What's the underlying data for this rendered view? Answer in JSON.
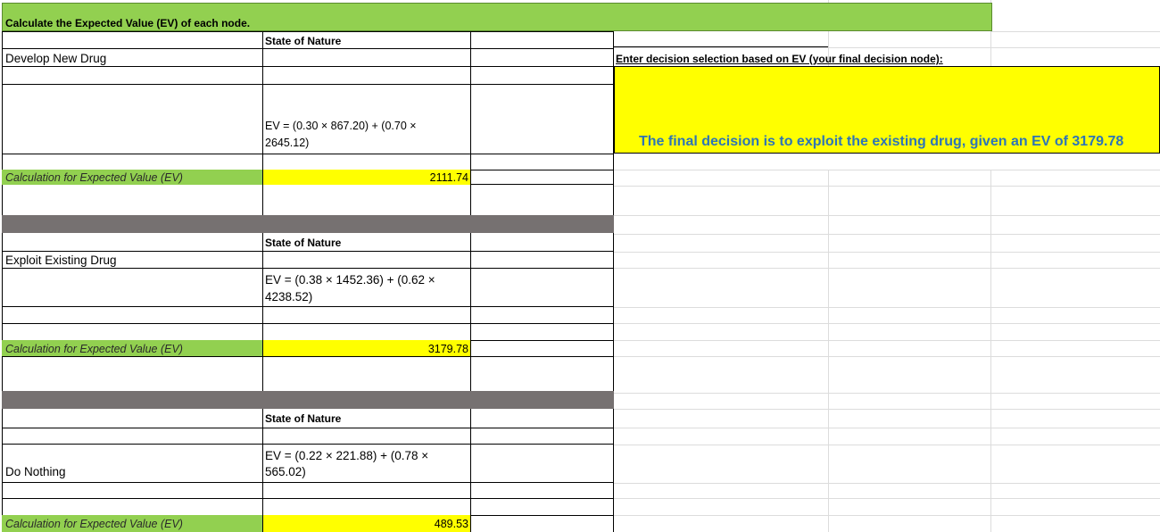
{
  "title": "Calculate the Expected Value (EV) of each node.",
  "decision_prompt": "Enter decision selection based on EV (your final decision node):",
  "decision_text": "The final decision is to exploit the existing drug, given an EV of 3179.78",
  "colors": {
    "green": "#92d050",
    "yellow": "#ffff00",
    "gray": "#767171",
    "decision_text": "#2e75b6"
  },
  "sections": [
    {
      "state_label": "State of Nature",
      "option": "Develop New Drug",
      "formula_line1": "EV = (0.30 × 867.20) + (0.70 ×",
      "formula_line2": "2645.12)",
      "calc_label": "Calculation for Expected Value (EV)",
      "ev": "2111.74"
    },
    {
      "state_label": "State of Nature",
      "option": "Exploit Existing Drug",
      "formula_line1": "EV = (0.38 × 1452.36) + (0.62 ×",
      "formula_line2": "4238.52)",
      "calc_label": "Calculation for Expected Value (EV)",
      "ev": "3179.78"
    },
    {
      "state_label": "State of Nature",
      "option": "Do Nothing",
      "formula_line1": "EV = (0.22 × 221.88) + (0.78 ×",
      "formula_line2": "565.02)",
      "calc_label": "Calculation for Expected Value (EV)",
      "ev": "489.53"
    }
  ]
}
